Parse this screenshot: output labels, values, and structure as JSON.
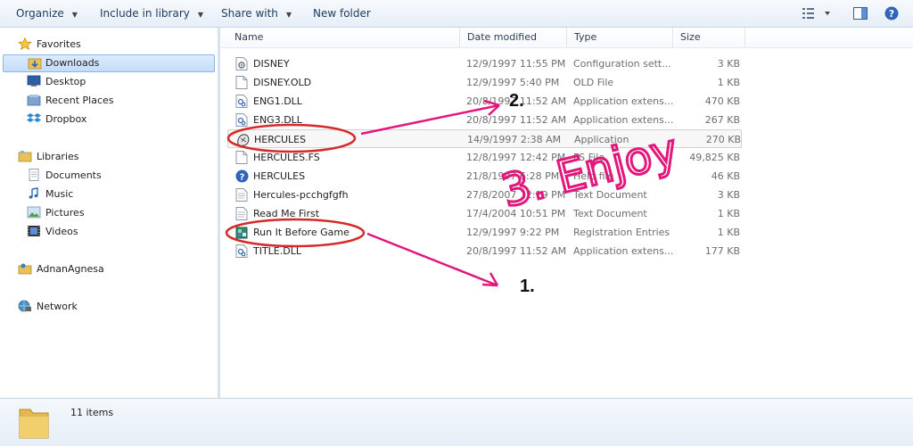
{
  "toolbar": {
    "organize": "Organize",
    "include_in_library": "Include in library",
    "share_with": "Share with",
    "new_folder": "New folder"
  },
  "nav": {
    "favorites": {
      "header": "Favorites",
      "items": [
        "Downloads",
        "Desktop",
        "Recent Places",
        "Dropbox"
      ],
      "selected": "Downloads"
    },
    "libraries": {
      "header": "Libraries",
      "items": [
        "Documents",
        "Music",
        "Pictures",
        "Videos"
      ]
    },
    "user": "AdnanAgnesa",
    "network": "Network"
  },
  "columns": {
    "name": "Name",
    "date_modified": "Date modified",
    "type": "Type",
    "size": "Size"
  },
  "files": [
    {
      "name": "DISNEY",
      "date": "12/9/1997 11:55 PM",
      "type": "Configuration sett...",
      "size": "3 KB",
      "icon": "config-file-icon"
    },
    {
      "name": "DISNEY.OLD",
      "date": "12/9/1997 5:40 PM",
      "type": "OLD File",
      "size": "1 KB",
      "icon": "file-icon"
    },
    {
      "name": "ENG1.DLL",
      "date": "20/8/1997 11:52 AM",
      "type": "Application extens...",
      "size": "470 KB",
      "icon": "dll-icon"
    },
    {
      "name": "ENG3.DLL",
      "date": "20/8/1997 11:52 AM",
      "type": "Application extens...",
      "size": "267 KB",
      "icon": "dll-icon"
    },
    {
      "name": "HERCULES",
      "date": "14/9/1997 2:38 AM",
      "type": "Application",
      "size": "270 KB",
      "icon": "app-icon"
    },
    {
      "name": "HERCULES.FS",
      "date": "12/8/1997 12:42 PM",
      "type": "FS File",
      "size": "49,825 KB",
      "icon": "file-icon"
    },
    {
      "name": "HERCULES",
      "date": "21/8/1997 6:28 PM",
      "type": "Help file",
      "size": "46 KB",
      "icon": "help-icon"
    },
    {
      "name": "Hercules-pcchgfgfh",
      "date": "27/8/2007 12:19 PM",
      "type": "Text Document",
      "size": "3 KB",
      "icon": "text-file-icon"
    },
    {
      "name": "Read Me First",
      "date": "17/4/2004 10:51 PM",
      "type": "Text Document",
      "size": "1 KB",
      "icon": "text-file-icon"
    },
    {
      "name": "Run It Before Game",
      "date": "12/9/1997 9:22 PM",
      "type": "Registration Entries",
      "size": "1 KB",
      "icon": "registry-icon"
    },
    {
      "name": "TITLE.DLL",
      "date": "20/8/1997 11:52 AM",
      "type": "Application extens...",
      "size": "177 KB",
      "icon": "dll-icon"
    }
  ],
  "status": {
    "count": "11 items"
  },
  "annotations": {
    "step1": "1.",
    "step2": "2.",
    "step3": "3. Enjoy",
    "color": "#e2177b",
    "circle_color": "#d42a2a"
  }
}
